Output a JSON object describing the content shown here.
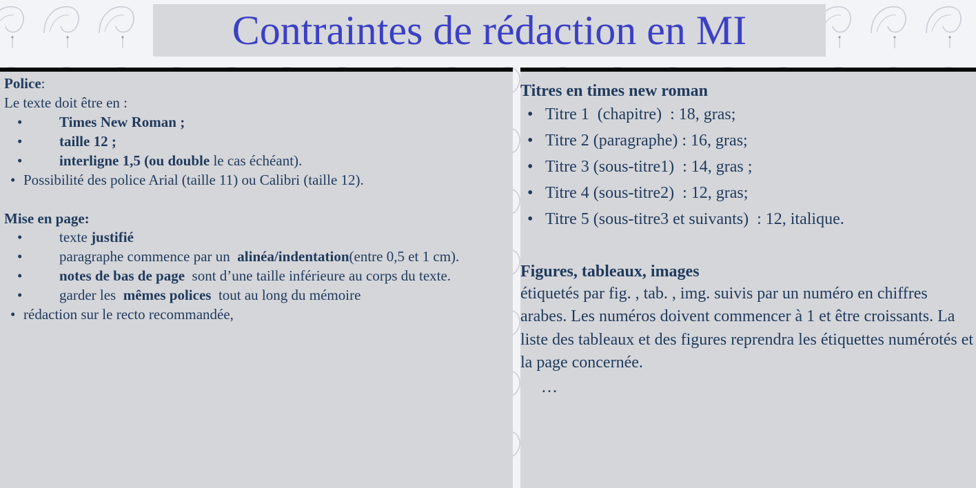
{
  "title": "Contraintes de rédaction en MI",
  "colors": {
    "title": "#3b40c4",
    "text": "#1f3a5c",
    "panel": "#d5d6da",
    "rule": "#0a0a0a"
  },
  "left": {
    "police": {
      "heading": "Police",
      "heading_suffix": ":",
      "intro": "Le texte doit être en  :",
      "items": [
        {
          "bold": "Times New Roman  ;"
        },
        {
          "bold": "taille 12  ;"
        },
        {
          "bold": "interligne 1,5  (ou double",
          "rest": " le cas échéant)."
        }
      ],
      "extra": "Possibilité des police Arial (taille 11) ou Calibri   (taille 12)."
    },
    "mise": {
      "heading": "Mise en page:",
      "items": [
        {
          "pre": "texte ",
          "bold": "justifié"
        },
        {
          "pre": "paragraphe commence par un  ",
          "bold": "alinéa/indentation",
          "post": "(entre 0,5 et 1 cm)."
        },
        {
          "bold": "notes de bas de page",
          "post": "  sont d’une taille inférieure au corps du texte."
        },
        {
          "pre": "garder les  ",
          "bold": "mêmes polices",
          "post": "  tout au long du mémoire"
        }
      ],
      "extra": "rédaction sur le recto recommandée,"
    }
  },
  "right": {
    "titres": {
      "heading": "Titres en times new roman",
      "items": [
        "Titre 1  (chapitre)  : 18, gras;",
        "Titre 2 (paragraphe) : 16, gras;",
        "Titre 3 (sous-titre1)  : 14, gras ;",
        "Titre 4 (sous-titre2)  : 12, gras;",
        "Titre 5 (sous-titre3 et suivants)  : 12, italique."
      ]
    },
    "figures": {
      "heading": "Figures, tableaux, images",
      "text": "étiquetés par fig. , tab. , img. suivis par un numéro en chiffres arabes. Les numéros doivent commencer à 1 et être croissants. La liste des tableaux et des figures reprendra les étiquettes numérotés et la page concernée.",
      "ellipsis": "…"
    }
  }
}
